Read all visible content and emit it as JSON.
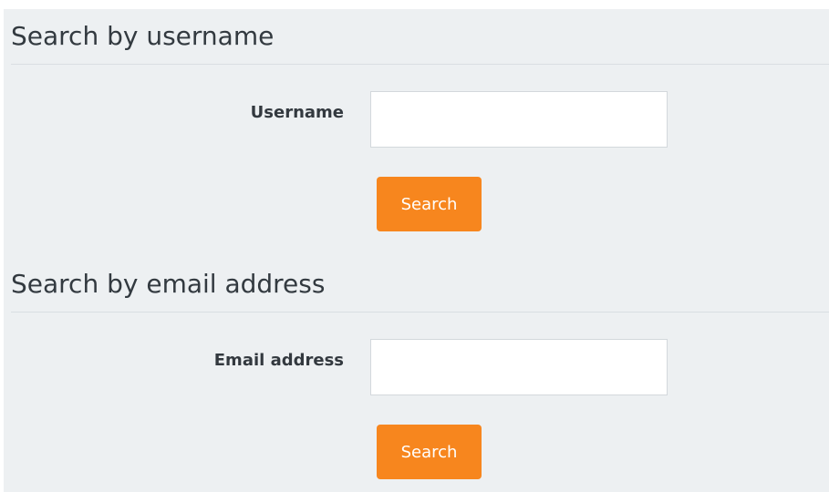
{
  "username_search": {
    "title": "Search by username",
    "field_label": "Username",
    "input_value": "",
    "button_label": "Search"
  },
  "email_search": {
    "title": "Search by email address",
    "field_label": "Email address",
    "input_value": "",
    "button_label": "Search"
  },
  "colors": {
    "panel_background": "#edf0f2",
    "button_background": "#f7861e",
    "button_text": "#ffffff"
  }
}
